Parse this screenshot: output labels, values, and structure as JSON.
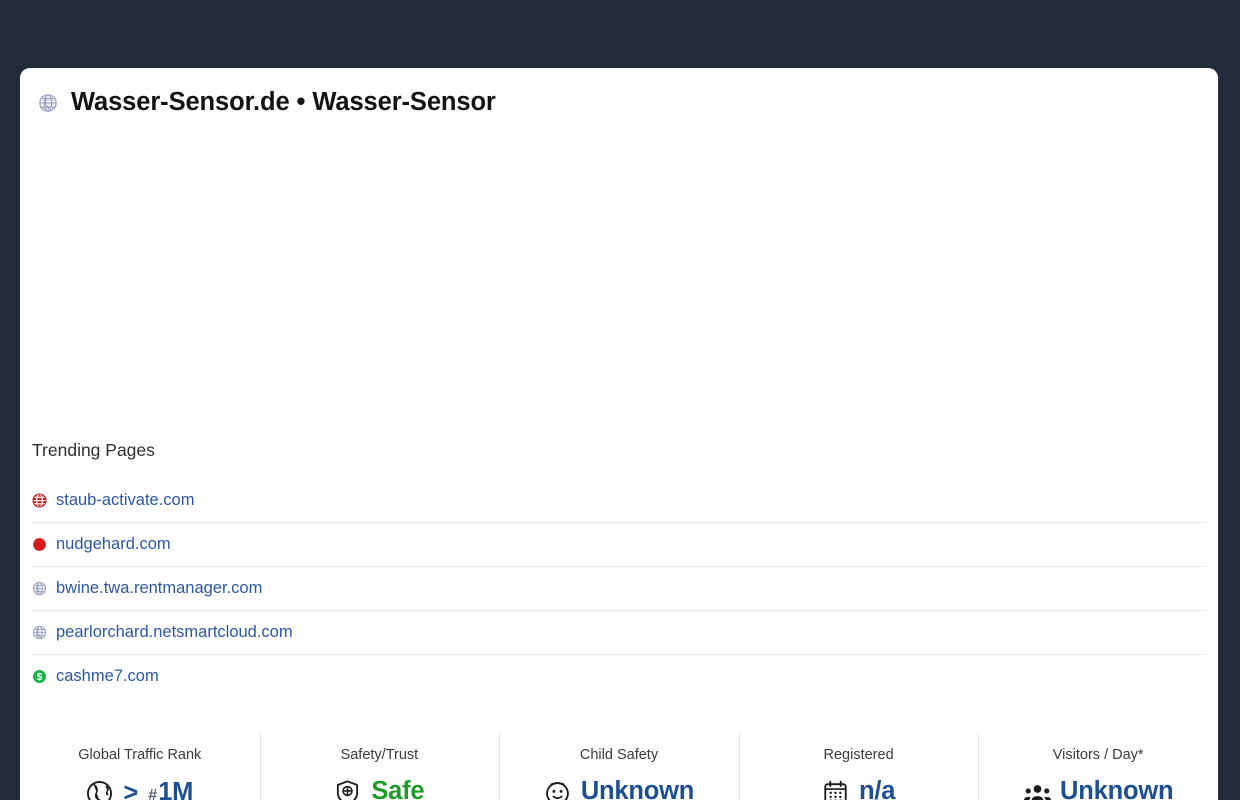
{
  "page": {
    "background_color": "#222b3a",
    "card_background": "#ffffff",
    "link_color": "#2c57a7",
    "accent_blue": "#1e4f91",
    "accent_green": "#1f9b26"
  },
  "header": {
    "favicon": "globe-icon",
    "title": "Wasser-Sensor.de • Wasser-Sensor"
  },
  "ad": {
    "placeholder": ""
  },
  "trending": {
    "heading": "Trending Pages",
    "items": [
      {
        "icon": "red-globe-icon",
        "label": "staub-activate.com"
      },
      {
        "icon": "red-circle-icon",
        "label": "nudgehard.com"
      },
      {
        "icon": "globe-icon",
        "label": "bwine.twa.rentmanager.com"
      },
      {
        "icon": "globe-icon",
        "label": "pearlorchard.netsmartcloud.com"
      },
      {
        "icon": "dollar-icon",
        "label": "cashme7.com"
      }
    ]
  },
  "stats": [
    {
      "label": "Global Traffic Rank",
      "icon": "globe-icon",
      "prefix": ">",
      "hash": "#",
      "value": "1M",
      "color": "#1e4f91"
    },
    {
      "label": "Safety/Trust",
      "icon": "shield-plus-icon",
      "prefix": "",
      "hash": "",
      "value": "Safe",
      "color": "#1f9b26"
    },
    {
      "label": "Child Safety",
      "icon": "baby-face-icon",
      "prefix": "",
      "hash": "",
      "value": "Unknown",
      "color": "#1e4f91"
    },
    {
      "label": "Registered",
      "icon": "calendar-icon",
      "prefix": "",
      "hash": "",
      "value": "n/a",
      "color": "#1e4f91"
    },
    {
      "label": "Visitors / Day*",
      "icon": "users-group-icon",
      "prefix": "",
      "hash": "",
      "value": "Unknown",
      "color": "#1e4f91"
    }
  ]
}
